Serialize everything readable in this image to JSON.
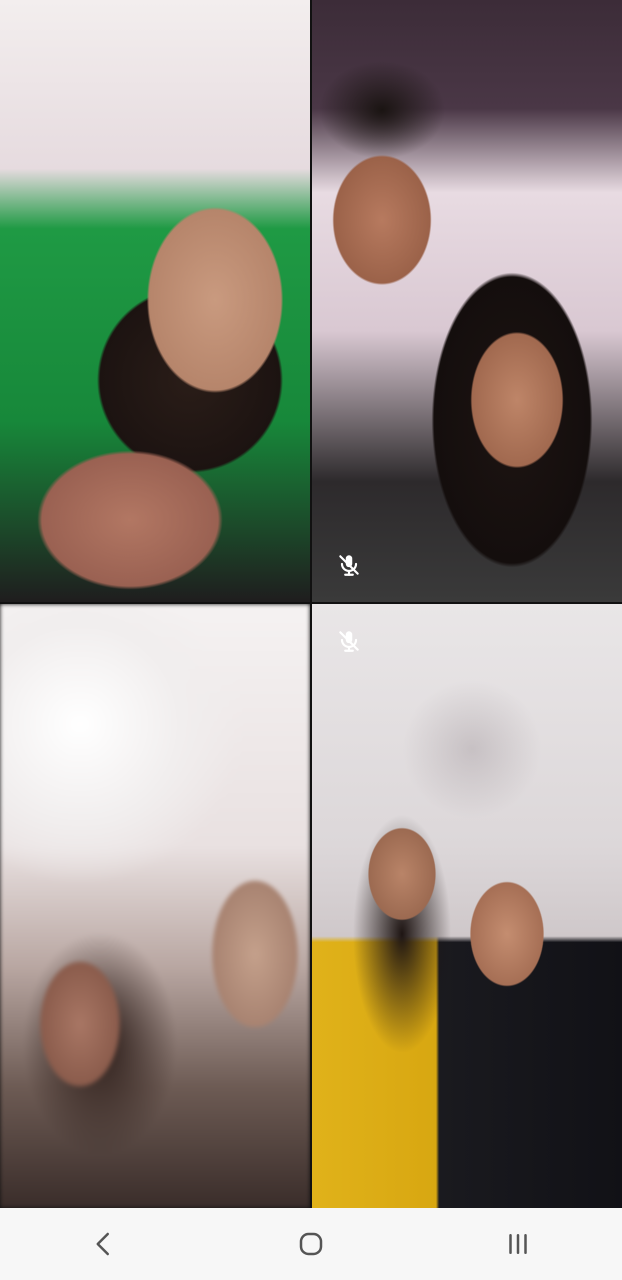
{
  "call": {
    "participants": [
      {
        "tile": "tile-1",
        "muted": false
      },
      {
        "tile": "tile-2",
        "muted": true
      },
      {
        "tile": "tile-3",
        "muted": false
      },
      {
        "tile": "tile-4",
        "muted": true
      }
    ]
  },
  "navbar": {
    "buttons": [
      {
        "name": "back-button",
        "icon": "chevron-left-icon"
      },
      {
        "name": "home-button",
        "icon": "rounded-square-icon"
      },
      {
        "name": "recents-button",
        "icon": "three-bars-icon"
      }
    ]
  },
  "colors": {
    "navbar_bg": "#f7f7f7",
    "nav_icon": "#555555",
    "mute_icon": "#ffffff"
  }
}
